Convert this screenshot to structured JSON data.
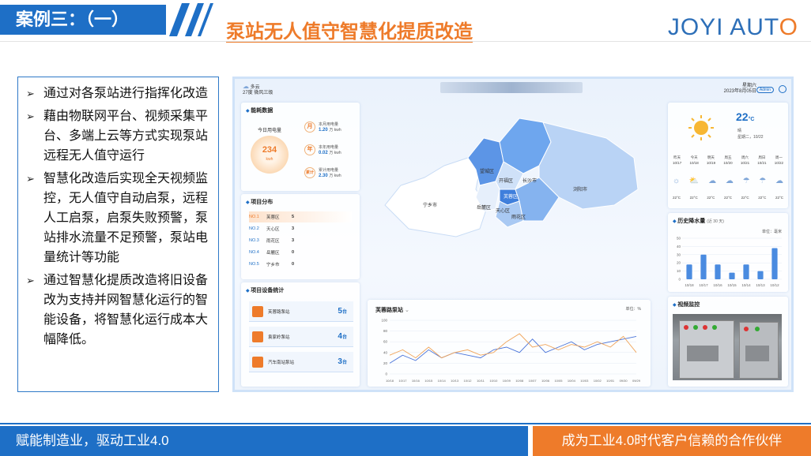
{
  "header": {
    "case_label": "案例三：（一）",
    "title": "泵站无人值守智慧化提质改造",
    "logo_main": "JOYI AUT",
    "logo_o": "O"
  },
  "bullets": [
    "通过对各泵站进行指挥化改造",
    "藉由物联网平台、视频采集平台、多端上云等方式实现泵站远程无人值守运行",
    "智慧化改造后实现全天视频监控，无人值守自动启泵，远程人工启泵，启泵失败预警，泵站排水流量不足预警，泵站电量统计等功能",
    "通过智慧化提质改造将旧设备改为支持并网智慧化运行的智能设备，将智慧化运行成本大幅降低。"
  ],
  "dashboard": {
    "weather_top": "多云",
    "weather_temp": "27度  微风三级",
    "weekday": "星期六",
    "date": "2023年8月05日",
    "admin": "Admin",
    "energy": {
      "title": "能耗数据",
      "today_label": "今日用电量",
      "today_value": "234",
      "today_unit": "kwh",
      "month_badge": "月",
      "month_label": "本月用电量",
      "month_value": "1.20",
      "month_unit": "万 kwh",
      "year_badge": "年",
      "year_label": "本年用电量",
      "year_value": "0.02",
      "year_unit": "万 kwh",
      "total_badge": "累计",
      "total_label": "累计用电量",
      "total_value": "2.30",
      "total_unit": "万 kwh"
    },
    "distribution": {
      "title": "项目分布",
      "rows": [
        {
          "no": "NO.1",
          "name": "芙蓉区",
          "count": "5"
        },
        {
          "no": "NO.2",
          "name": "天心区",
          "count": "3"
        },
        {
          "no": "NO.3",
          "name": "雨花区",
          "count": "3"
        },
        {
          "no": "NO.4",
          "name": "岳麓区",
          "count": "0"
        },
        {
          "no": "NO.5",
          "name": "宁乡市",
          "count": "0"
        }
      ]
    },
    "devices": {
      "title": "项目设备统计",
      "rows": [
        {
          "name": "芙蓉路泵站",
          "count": "5",
          "unit": "台"
        },
        {
          "name": "袁家岭泵站",
          "count": "4",
          "unit": "台"
        },
        {
          "name": "汽车南站泵站",
          "count": "3",
          "unit": "台"
        }
      ]
    },
    "map_labels": [
      "望城区",
      "开福区",
      "长沙市",
      "浏阳市",
      "宁乡市",
      "岳麓区",
      "芙蓉区",
      "雨花区",
      "天心区"
    ],
    "weather_panel": {
      "temp": "22",
      "unit": "°C",
      "condition": "晴",
      "day_date": "星期二，10/22",
      "days": [
        {
          "d": "昨天",
          "date": "10/17"
        },
        {
          "d": "今天",
          "date": "10/18"
        },
        {
          "d": "明天",
          "date": "10/19"
        },
        {
          "d": "周五",
          "date": "10/20"
        },
        {
          "d": "周六",
          "date": "10/21"
        },
        {
          "d": "周日",
          "date": "10/21"
        },
        {
          "d": "周一",
          "date": "10/22"
        }
      ],
      "temps": [
        "22°C",
        "22°C",
        "22°C",
        "22°C",
        "22°C",
        "22°C",
        "22°C"
      ]
    },
    "rain_chart": {
      "title": "历史降水量",
      "subtitle": "(近 30 天)",
      "unit": "单位：毫米"
    },
    "line_chart": {
      "title": "芙蓉路泵站",
      "unit": "单位：%"
    },
    "video": {
      "title": "视频监控"
    }
  },
  "chart_data": [
    {
      "type": "bar",
      "title": "历史降水量",
      "categories": [
        "10/18",
        "10/17",
        "10/16",
        "10/15",
        "10/14",
        "10/13",
        "10/12"
      ],
      "values": [
        18,
        30,
        18,
        8,
        18,
        10,
        38
      ],
      "ylim": [
        0,
        50
      ],
      "yticks": [
        0,
        10,
        20,
        30,
        40,
        50
      ]
    },
    {
      "type": "line",
      "title": "芙蓉路泵站",
      "x": [
        "10/18",
        "10/17",
        "10/16",
        "10/15",
        "10/14",
        "10/13",
        "10/12",
        "10/11",
        "10/10",
        "10/09",
        "10/08",
        "10/07",
        "10/06",
        "10/05",
        "10/04",
        "10/03",
        "10/02",
        "10/01",
        "09/30",
        "09/29"
      ],
      "series": [
        {
          "values": [
            20,
            35,
            25,
            45,
            30,
            40,
            35,
            30,
            45,
            50,
            40,
            65,
            40,
            50,
            60,
            45,
            55,
            60,
            65,
            70
          ]
        },
        {
          "values": [
            35,
            45,
            30,
            50,
            30,
            40,
            45,
            35,
            40,
            60,
            75,
            50,
            55,
            45,
            55,
            50,
            60,
            50,
            70,
            40
          ]
        }
      ],
      "ylim": [
        0,
        100
      ],
      "yticks": [
        0,
        20,
        40,
        60,
        80,
        100
      ],
      "colors": [
        "#4a74d9",
        "#f0a45a"
      ]
    }
  ],
  "footer": {
    "left": "赋能制造业，驱动工业4.0",
    "right": "成为工业4.0时代客户信赖的合作伙伴"
  }
}
